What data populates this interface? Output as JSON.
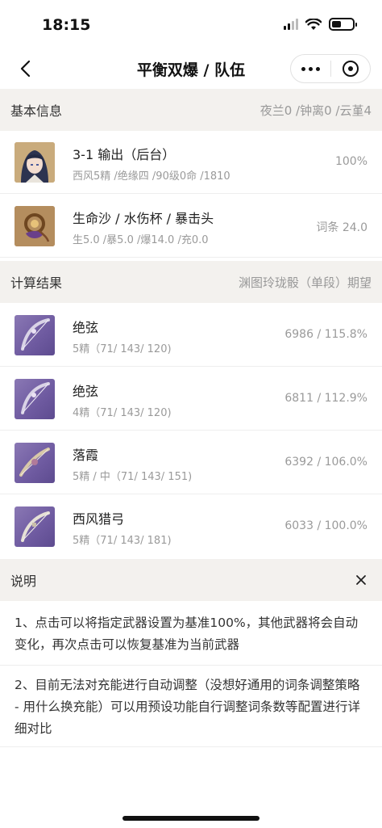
{
  "status": {
    "time": "18:15"
  },
  "nav": {
    "title": "平衡双爆 / 队伍"
  },
  "basic": {
    "title": "基本信息",
    "meta": "夜兰0 /钟离0 /云堇4",
    "character": {
      "title": "3-1 输出（后台）",
      "sub": "西风5精 /绝缘四 /90级0命 /1810",
      "value": "100%"
    },
    "artifact": {
      "title": "生命沙 / 水伤杯 / 暴击头",
      "sub": "生5.0 /暴5.0 /爆14.0 /充0.0",
      "value": "词条 24.0"
    }
  },
  "results": {
    "title": "计算结果",
    "meta": "渊图玲珑骰（单段）期望",
    "weapons": [
      {
        "name": "绝弦",
        "sub": "5精（71/ 143/ 120)",
        "value": "6986 / 115.8%"
      },
      {
        "name": "绝弦",
        "sub": "4精（71/ 143/ 120)",
        "value": "6811 / 112.9%"
      },
      {
        "name": "落霞",
        "sub": "5精 / 中（71/ 143/ 151)",
        "value": "6392 / 106.0%"
      },
      {
        "name": "西风猎弓",
        "sub": "5精（71/ 143/ 181)",
        "value": "6033 / 100.0%"
      }
    ]
  },
  "notes": {
    "title": "说明",
    "items": [
      "1、点击可以将指定武器设置为基准100%，其他武器将会自动变化，再次点击可以恢复基准为当前武器",
      "2、目前无法对充能进行自动调整（没想好通用的词条调整策略 - 用什么换充能）可以用预设功能自行调整词条数等配置进行详细对比"
    ]
  },
  "colors": {
    "section_bg": "#f3f1ee",
    "weapon_bg": "#7b67aa",
    "muted_text": "#9a9a9a"
  },
  "icons": [
    "signal-icon",
    "wifi-icon",
    "battery-icon",
    "back-arrow-icon",
    "more-dots-icon",
    "target-icon",
    "close-icon",
    "character-avatar",
    "artifact-icon",
    "bow-icon"
  ]
}
